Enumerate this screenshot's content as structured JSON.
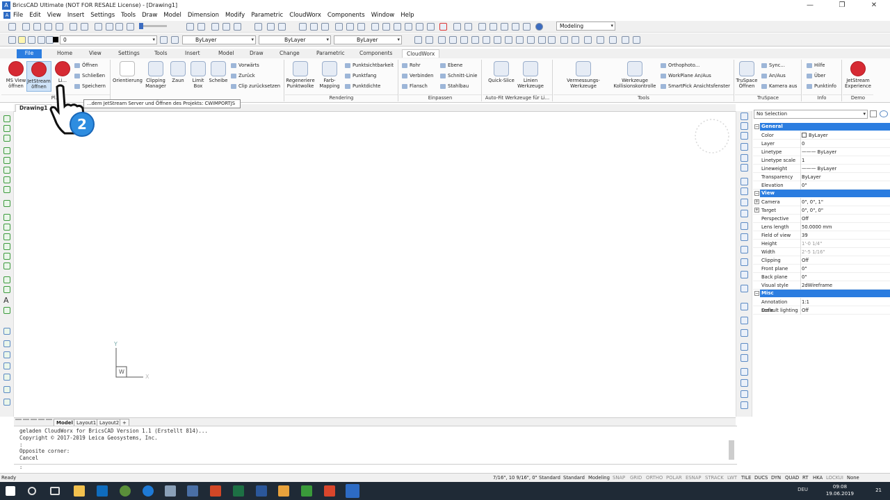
{
  "window": {
    "title": "BricsCAD Ultimate (NOT FOR RESALE License) - [Drawing1]",
    "app_icon": "A",
    "controls": [
      "—",
      "❐",
      "✕"
    ]
  },
  "menubar": [
    "File",
    "Edit",
    "View",
    "Insert",
    "Settings",
    "Tools",
    "Draw",
    "Model",
    "Dimension",
    "Modify",
    "Parametric",
    "CloudWorx",
    "Components",
    "Window",
    "Help"
  ],
  "toolbar": {
    "workspace": "Modeling",
    "layer": "0",
    "color": "ByLayer",
    "linetype": "ByLayer",
    "lineweight": "ByLayer"
  },
  "ribbon_tabs": [
    "File",
    "Home",
    "View",
    "Settings",
    "Tools",
    "Insert",
    "Model",
    "Draw",
    "Change",
    "Parametric",
    "Components",
    "CloudWorx"
  ],
  "ribbon": {
    "big_buttons": [
      {
        "label1": "MS View",
        "label2": "öffnen"
      },
      {
        "label1": "JetStream",
        "label2": "öffnen"
      },
      {
        "label1": "Li...",
        "label2": ""
      },
      {
        "label1": "Orientierung",
        "label2": ""
      },
      {
        "label1": "Clipping",
        "label2": "Manager"
      },
      {
        "label1": "Zaun",
        "label2": ""
      },
      {
        "label1": "Limit",
        "label2": "Box"
      },
      {
        "label1": "Scheibe",
        "label2": ""
      },
      {
        "label1": "Regeneriere",
        "label2": "Punktwolke"
      },
      {
        "label1": "Farb-",
        "label2": "Mapping"
      },
      {
        "label1": "Quick-Slice",
        "label2": ""
      },
      {
        "label1": "Linien",
        "label2": "Werkzeuge"
      },
      {
        "label1": "Vermessungs-Werkzeuge",
        "label2": ""
      },
      {
        "label1": "Werkzeuge",
        "label2": "Kollisionskontrolle"
      },
      {
        "label1": "TruSpace",
        "label2": "Öffnen"
      },
      {
        "label1": "JetStream",
        "label2": "Experience"
      }
    ],
    "small_buttons": [
      "Öffnen",
      "Schließen",
      "Speichern",
      "Vorwärts",
      "Zurück",
      "Clip zurücksetzen",
      "Punktsichtbarkeit",
      "Punktfang",
      "Punktdichte",
      "Rohr",
      "Verbinden",
      "Flansch",
      "Ebene",
      "Schnitt-Linie",
      "Stahlbau",
      "Orthophoto...",
      "WorkPlane An/Aus",
      "SmartPick Ansichtsfenster",
      "Sync...",
      "An/Aus",
      "Kamera aus",
      "Hilfe",
      "Über",
      "Punktinfo"
    ],
    "panels": [
      "Pl...",
      "Rendering",
      "Einpassen",
      "Auto-Fit Werkzeuge für Li...",
      "Tools",
      "TruSpace",
      "Info",
      "Demo"
    ]
  },
  "tooltip": "...dem JetStream Server und Öffnen des Projekts: CWIMPORTJS",
  "document_tab": "Drawing1",
  "ucs": {
    "y": "Y",
    "x": "X",
    "w": "W"
  },
  "properties": {
    "selection": "No Selection",
    "sections": [
      {
        "title": "General",
        "rows": [
          {
            "k": "Color",
            "v": "ByLayer"
          },
          {
            "k": "Layer",
            "v": "0"
          },
          {
            "k": "Linetype",
            "v": "——— ByLayer"
          },
          {
            "k": "Linetype scale",
            "v": "1"
          },
          {
            "k": "Lineweight",
            "v": "——— ByLayer"
          },
          {
            "k": "Transparency",
            "v": "ByLayer"
          },
          {
            "k": "Elevation",
            "v": "0\""
          }
        ]
      },
      {
        "title": "View",
        "rows": [
          {
            "k": "Camera",
            "v": "0\", 0\", 1\""
          },
          {
            "k": "Target",
            "v": "0\", 0\", 0\""
          },
          {
            "k": "Perspective",
            "v": "Off"
          },
          {
            "k": "Lens length",
            "v": "50.0000 mm"
          },
          {
            "k": "Field of view",
            "v": "39"
          },
          {
            "k": "Height",
            "v": "1'-0 1/4\""
          },
          {
            "k": "Width",
            "v": "2'-5 1/16\""
          },
          {
            "k": "Clipping",
            "v": "Off"
          },
          {
            "k": "Front plane",
            "v": "0\""
          },
          {
            "k": "Back plane",
            "v": "0\""
          },
          {
            "k": "Visual style",
            "v": "2dWireframe"
          }
        ]
      },
      {
        "title": "Misc",
        "rows": [
          {
            "k": "Annotation scale",
            "v": "1:1"
          },
          {
            "k": "Default lighting",
            "v": "Off"
          }
        ]
      }
    ]
  },
  "layout_tabs": [
    "Model",
    "Layout1",
    "Layout2",
    "+"
  ],
  "command_history": [
    "geladen CloudWorx for BricsCAD Version 1.1 (Erstellt 814)...",
    "Copyright © 2017-2019 Leica Geosystems, Inc.",
    ":",
    "Opposite corner:",
    "Cancel"
  ],
  "command_prompt": ":",
  "status": {
    "ready": "Ready",
    "coords": "7/16\", 10 9/16\", 0\"",
    "items": [
      "Standard",
      "Standard",
      "Modeling",
      "SNAP",
      "GRID",
      "ORTHO",
      "POLAR",
      "ESNAP",
      "STRACK",
      "LWT",
      "TILE",
      "DUCS",
      "DYN",
      "QUAD",
      "RT",
      "HKA",
      "LOCKUI",
      "None"
    ]
  },
  "clock": {
    "time": "09:08",
    "date": "19.06.2019",
    "lang": "DEU",
    "notif": "21"
  },
  "colors": {
    "accent": "#2b7de0",
    "jetstream_red": "#d62a33",
    "taskbar": "#1f2a36"
  }
}
